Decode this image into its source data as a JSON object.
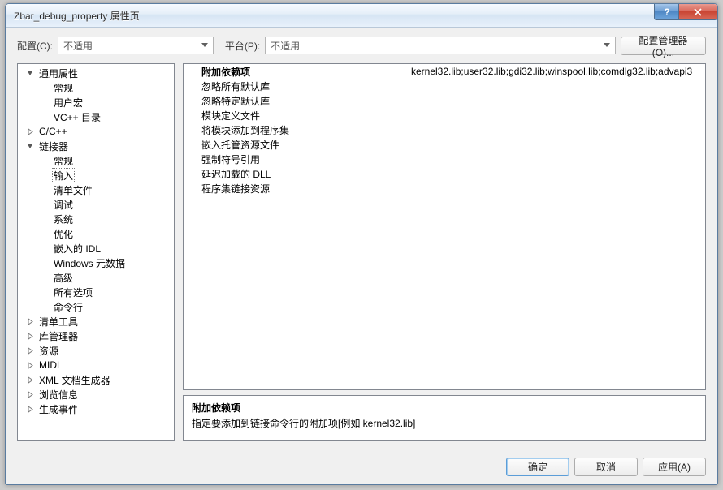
{
  "window": {
    "title": "Zbar_debug_property 属性页"
  },
  "title_controls": {
    "help": "?",
    "close": "×"
  },
  "cfg": {
    "config_label": "配置(C):",
    "config_value": "不适用",
    "platform_label": "平台(P):",
    "platform_value": "不适用",
    "manager_label": "配置管理器(O)..."
  },
  "tree": [
    {
      "lvl": 0,
      "exp": "open",
      "label": "通用属性"
    },
    {
      "lvl": 1,
      "exp": "none",
      "label": "常规"
    },
    {
      "lvl": 1,
      "exp": "none",
      "label": "用户宏"
    },
    {
      "lvl": 1,
      "exp": "none",
      "label": "VC++ 目录"
    },
    {
      "lvl": 0,
      "exp": "closed",
      "label": "C/C++"
    },
    {
      "lvl": 0,
      "exp": "open",
      "label": "链接器"
    },
    {
      "lvl": 1,
      "exp": "none",
      "label": "常规"
    },
    {
      "lvl": 1,
      "exp": "none",
      "label": "输入",
      "selected": true
    },
    {
      "lvl": 1,
      "exp": "none",
      "label": "清单文件"
    },
    {
      "lvl": 1,
      "exp": "none",
      "label": "调试"
    },
    {
      "lvl": 1,
      "exp": "none",
      "label": "系统"
    },
    {
      "lvl": 1,
      "exp": "none",
      "label": "优化"
    },
    {
      "lvl": 1,
      "exp": "none",
      "label": "嵌入的 IDL"
    },
    {
      "lvl": 1,
      "exp": "none",
      "label": "Windows 元数据"
    },
    {
      "lvl": 1,
      "exp": "none",
      "label": "高级"
    },
    {
      "lvl": 1,
      "exp": "none",
      "label": "所有选项"
    },
    {
      "lvl": 1,
      "exp": "none",
      "label": "命令行"
    },
    {
      "lvl": 0,
      "exp": "closed",
      "label": "清单工具"
    },
    {
      "lvl": 0,
      "exp": "closed",
      "label": "库管理器"
    },
    {
      "lvl": 0,
      "exp": "closed",
      "label": "资源"
    },
    {
      "lvl": 0,
      "exp": "closed",
      "label": "MIDL"
    },
    {
      "lvl": 0,
      "exp": "closed",
      "label": "XML 文档生成器"
    },
    {
      "lvl": 0,
      "exp": "closed",
      "label": "浏览信息"
    },
    {
      "lvl": 0,
      "exp": "closed",
      "label": "生成事件"
    }
  ],
  "grid": [
    {
      "name": "附加依赖项",
      "value": "kernel32.lib;user32.lib;gdi32.lib;winspool.lib;comdlg32.lib;advapi3",
      "bold": true
    },
    {
      "name": "忽略所有默认库",
      "value": ""
    },
    {
      "name": "忽略特定默认库",
      "value": ""
    },
    {
      "name": "模块定义文件",
      "value": ""
    },
    {
      "name": "将模块添加到程序集",
      "value": ""
    },
    {
      "name": "嵌入托管资源文件",
      "value": ""
    },
    {
      "name": "强制符号引用",
      "value": ""
    },
    {
      "name": "延迟加载的 DLL",
      "value": ""
    },
    {
      "name": "程序集链接资源",
      "value": ""
    }
  ],
  "desc": {
    "title": "附加依赖项",
    "text": "指定要添加到链接命令行的附加项[例如 kernel32.lib]"
  },
  "buttons": {
    "ok": "确定",
    "cancel": "取消",
    "apply": "应用(A)"
  },
  "watermark": ""
}
